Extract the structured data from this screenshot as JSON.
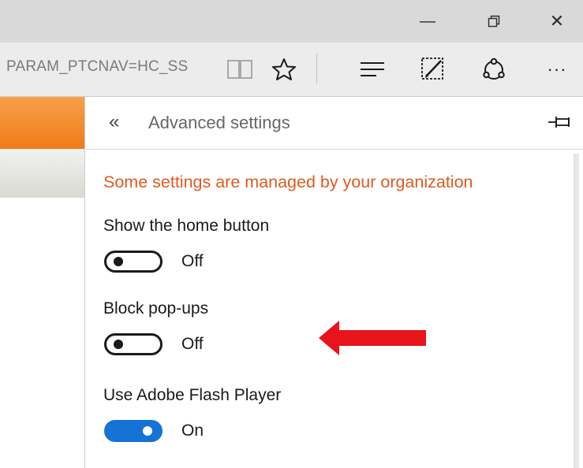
{
  "window": {
    "minimize_glyph": "—",
    "close_glyph": "✕"
  },
  "toolbar": {
    "url_text": "PARAM_PTCNAV=HC_SS",
    "icons": [
      "reading-view-icon",
      "favorite-star-icon",
      "hub-icon",
      "web-note-icon",
      "share-icon",
      "more-icon"
    ],
    "more_glyph": "···"
  },
  "panel": {
    "back_glyph": "«",
    "title": "Advanced settings",
    "managed_notice": "Some settings are managed by your organization",
    "settings": [
      {
        "label": "Show the home button",
        "state": "Off"
      },
      {
        "label": "Block pop-ups",
        "state": "Off"
      },
      {
        "label": "Use Adobe Flash Player",
        "state": "On"
      }
    ]
  },
  "colors": {
    "managed_text": "#e05a20",
    "toggle_on": "#1573d6",
    "arrow": "#e8141b",
    "page_accent": "#f07b16"
  }
}
